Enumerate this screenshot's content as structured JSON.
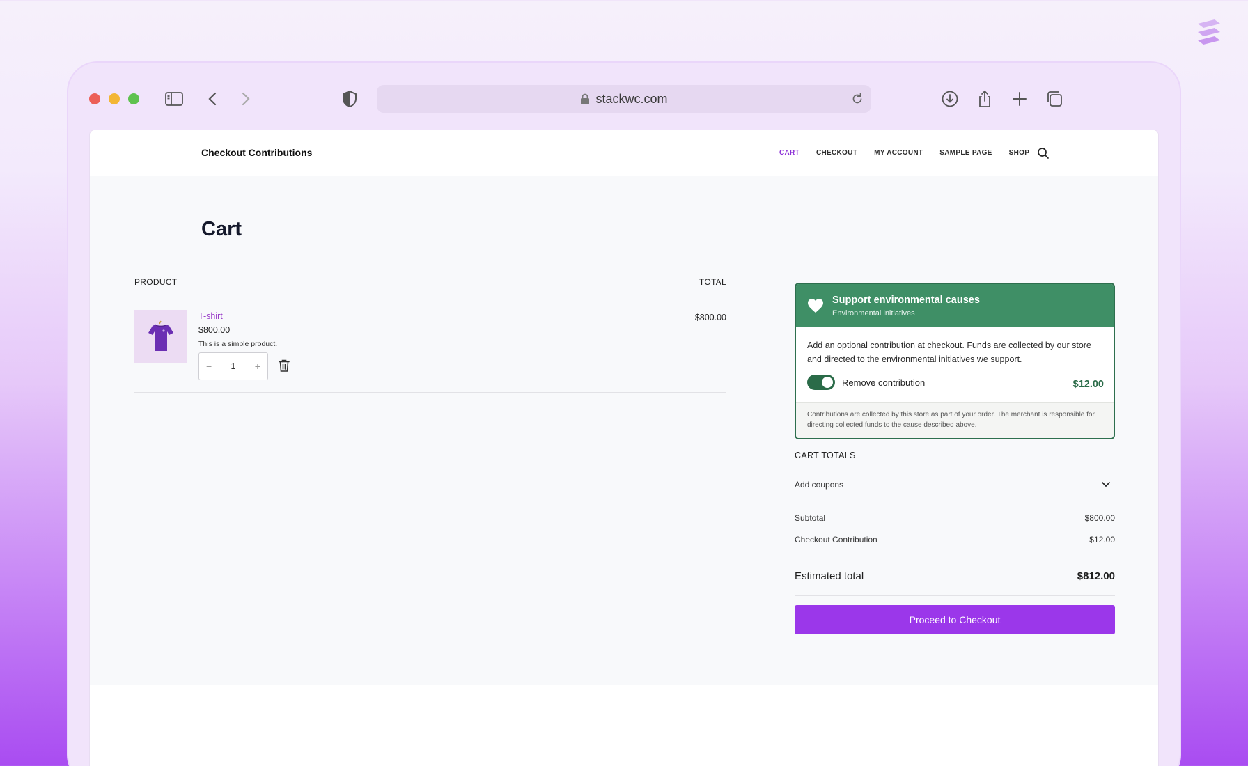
{
  "browser": {
    "url": "stackwc.com"
  },
  "site": {
    "title": "Checkout Contributions",
    "nav": [
      {
        "label": "CART",
        "active": true
      },
      {
        "label": "CHECKOUT",
        "active": false
      },
      {
        "label": "MY ACCOUNT",
        "active": false
      },
      {
        "label": "SAMPLE PAGE",
        "active": false
      },
      {
        "label": "SHOP",
        "active": false
      }
    ]
  },
  "page": {
    "title": "Cart"
  },
  "cart": {
    "columns": {
      "product": "PRODUCT",
      "total": "TOTAL"
    },
    "items": [
      {
        "name": "T-shirt",
        "price": "$800.00",
        "description": "This is a simple product.",
        "quantity": "1",
        "line_total": "$800.00",
        "qty_minus": "−",
        "qty_plus": "+"
      }
    ]
  },
  "contribution": {
    "title": "Support environmental causes",
    "subtitle": "Environmental initiatives",
    "body": "Add an optional contribution at checkout. Funds are collected by our store and directed to the environmental initiatives we support.",
    "toggle_label": "Remove contribution",
    "toggle_on": true,
    "amount": "$12.00",
    "footnote": "Contributions are collected by this store as part of your order. The merchant is responsible for directing collected funds to the cause described above.",
    "color_header": "#3f8f66",
    "color_accent": "#2a6b48"
  },
  "totals": {
    "heading": "CART TOTALS",
    "coupons_label": "Add coupons",
    "rows": [
      {
        "label": "Subtotal",
        "value": "$800.00"
      },
      {
        "label": "Checkout Contribution",
        "value": "$12.00"
      }
    ],
    "estimated_label": "Estimated total",
    "estimated_value": "$812.00",
    "checkout_button": "Proceed to Checkout",
    "button_color": "#9b37ea"
  },
  "icons": {
    "sidebar": "sidebar-icon",
    "back": "chevron-left-icon",
    "forward": "chevron-right-icon",
    "shield": "shield-icon",
    "lock": "lock-icon",
    "reload": "reload-icon",
    "download": "download-icon",
    "share": "share-icon",
    "new_tab": "plus-icon",
    "tabs": "tabs-icon",
    "search": "search-icon",
    "trash": "trash-icon",
    "heart": "heart-icon",
    "chevron_down": "chevron-down-icon"
  }
}
